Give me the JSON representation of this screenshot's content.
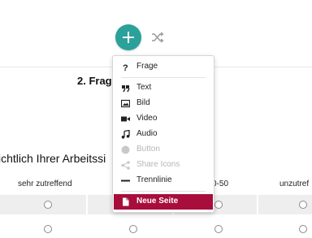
{
  "toolbar": {
    "add_icon": "plus-icon",
    "shuffle_icon": "shuffle-icon"
  },
  "page_heading": "2. Frage",
  "question_text": "ichtlich Ihrer Arbeitssi",
  "scale": {
    "labels": [
      "sehr zutreffend",
      "0-50",
      "unzutref"
    ]
  },
  "insert_menu": {
    "items": [
      {
        "label": "Frage",
        "icon": "question-icon"
      },
      {
        "label": "Text",
        "icon": "quote-icon"
      },
      {
        "label": "Bild",
        "icon": "image-icon"
      },
      {
        "label": "Video",
        "icon": "video-camera-icon"
      },
      {
        "label": "Audio",
        "icon": "music-note-icon"
      },
      {
        "label": "Button",
        "icon": "button-dot-icon",
        "disabled": true
      },
      {
        "label": "Share Icons",
        "icon": "share-icon",
        "disabled": true
      },
      {
        "label": "Trennlinie",
        "icon": "divider-line-icon"
      },
      {
        "label": "Neue Seite",
        "icon": "new-page-icon",
        "active": true
      }
    ]
  },
  "colors": {
    "accent_teal": "#2aa19a",
    "active_crimson": "#a80e3b"
  }
}
